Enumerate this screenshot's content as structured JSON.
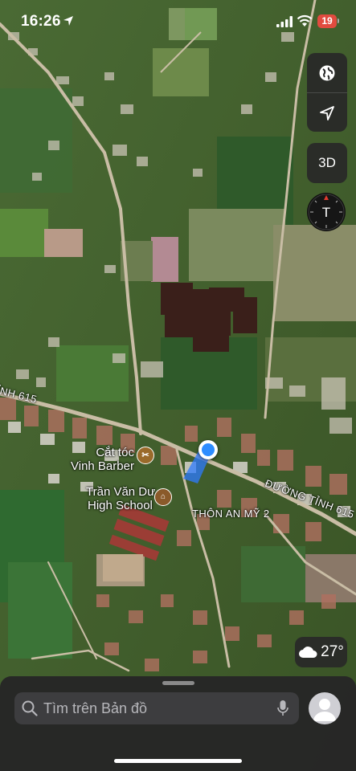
{
  "status_bar": {
    "time": "16:26",
    "battery": "19"
  },
  "map_controls": {
    "view_3d_label": "3D",
    "compass_letter": "T"
  },
  "poi": {
    "barber_line1": "Cắt tóc",
    "barber_line2": "Vinh Barber",
    "school_line1": "Trần Văn Dư",
    "school_line2": "High School"
  },
  "road_labels": {
    "left_road": "ỈNH 615",
    "right_road": "ĐƯỜNG TỈNH 615"
  },
  "area_label": "THÔN AN MỸ 2",
  "weather": {
    "temperature": "27°"
  },
  "search": {
    "placeholder": "Tìm trên Bản đồ"
  },
  "colors": {
    "user_location": "#2d8cff",
    "battery_low": "#e14b3f"
  }
}
